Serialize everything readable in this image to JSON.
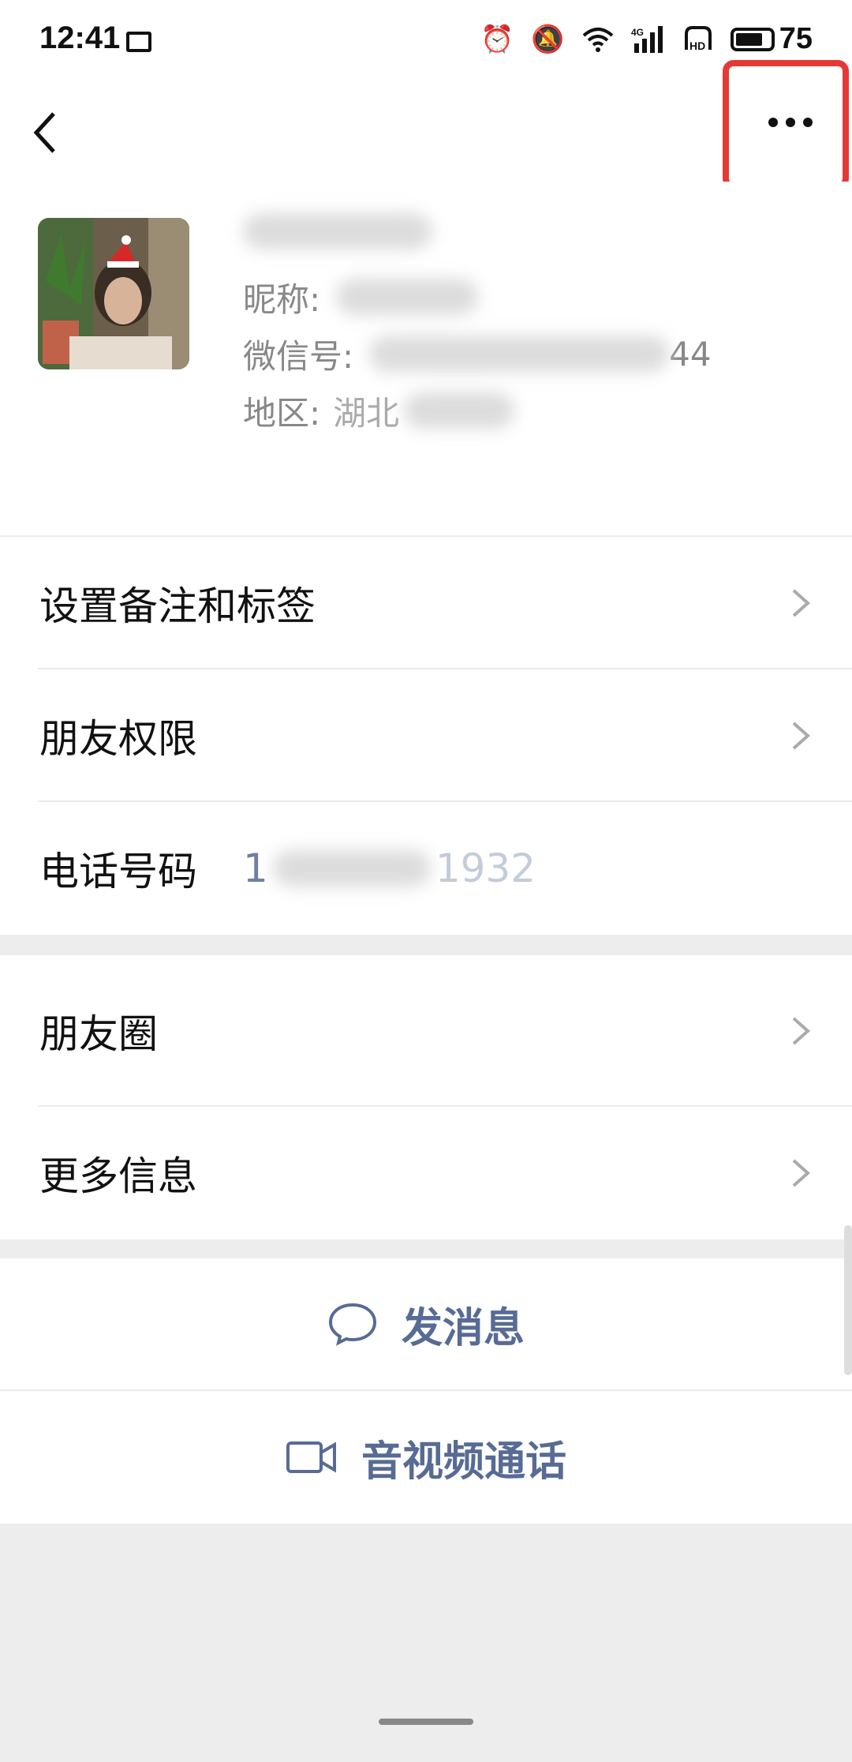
{
  "status_bar": {
    "time": "12:41",
    "battery_level": "75",
    "icons": [
      "image-icon",
      "alarm-icon",
      "mute-icon",
      "wifi-icon",
      "signal-4g-icon",
      "hd-icon",
      "battery-icon"
    ]
  },
  "nav": {
    "back_icon": "back-arrow-icon",
    "more_icon": "more-dots-icon"
  },
  "profile": {
    "nickname_label": "昵称:",
    "wechat_id_label": "微信号:",
    "wechat_id_tail": "44",
    "region_label": "地区:",
    "region_value": "湖北"
  },
  "menu_group_1": {
    "remark_tags": "设置备注和标签",
    "friend_permissions": "朋友权限",
    "phone_label": "电话号码",
    "phone_head": "1",
    "phone_tail": "1932"
  },
  "menu_group_2": {
    "moments": "朋友圈",
    "more_info": "更多信息"
  },
  "actions": {
    "send_message": "发消息",
    "av_call": "音视频通话"
  },
  "colors": {
    "link_blue": "#576b95",
    "highlight_red": "#e53935",
    "background": "#ededed"
  }
}
